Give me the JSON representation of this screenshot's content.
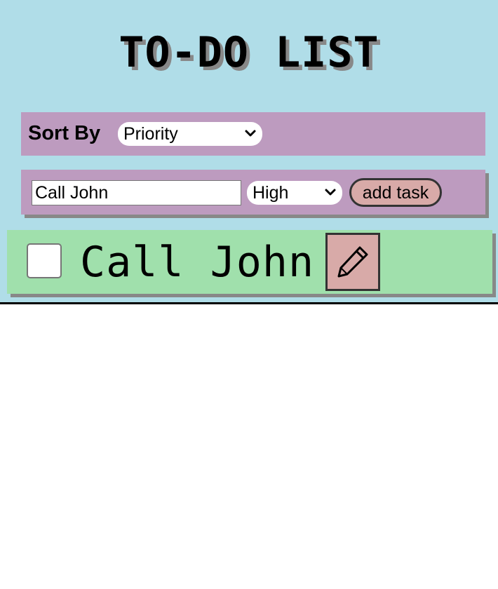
{
  "app": {
    "title": "TO-DO LIST",
    "background_color": "#b0dde8"
  },
  "sort": {
    "label": "Sort By",
    "selected": "Priority"
  },
  "add_task": {
    "input_value": "Call John",
    "priority_selected": "High",
    "button_label": "add task"
  },
  "tasks": [
    {
      "text": "Call John",
      "completed": false,
      "row_color": "#a0e0ac",
      "edit_icon": "pencil-icon"
    }
  ],
  "colors": {
    "panel": "#bd9bbf",
    "button": "#d8aaa8",
    "task_row": "#a0e0ac"
  }
}
